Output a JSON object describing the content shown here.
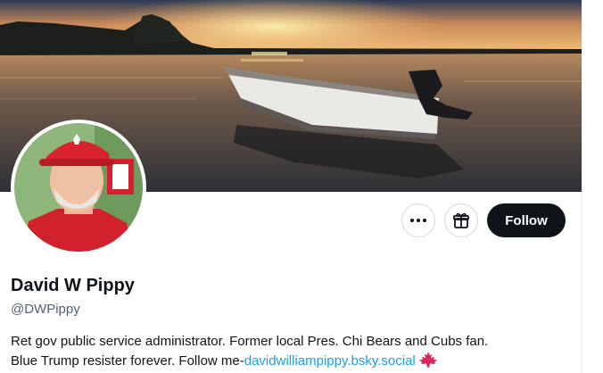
{
  "profile": {
    "display_name": "David W Pippy",
    "handle": "@DWPippy",
    "bio_line1": "Ret gov public service administrator. Former local Pres. Chi Bears and Cubs fan.",
    "bio_line2_prefix": "Blue Trump resister forever. Follow me-",
    "bio_link": "davidwilliampippy.bsky.social",
    "bio_emoji": "maple-leaf-icon"
  },
  "actions": {
    "more_icon": "more-dots-icon",
    "gift_icon": "gift-icon",
    "follow_label": "Follow"
  },
  "colors": {
    "follow_bg": "#0f1419",
    "link": "#1d9bf0",
    "secondary_text": "#536471",
    "maple": "#e0245e"
  }
}
